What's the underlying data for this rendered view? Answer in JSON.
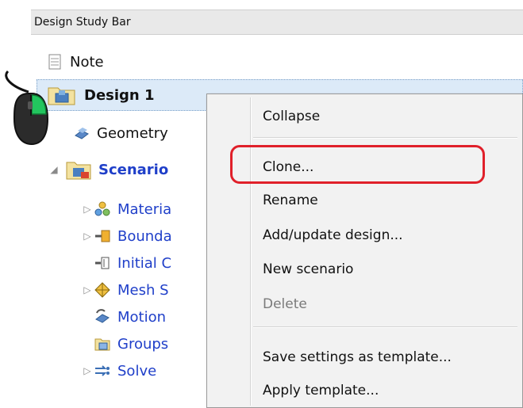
{
  "header": {
    "title": "Design Study Bar"
  },
  "tree": {
    "items": [
      {
        "label": "Note",
        "icon": "note-icon"
      },
      {
        "label": "Design 1",
        "icon": "design-folder-icon"
      },
      {
        "label": "Geometry",
        "icon": "geometry-icon"
      },
      {
        "label": "Scenario",
        "icon": "scenario-folder-icon"
      },
      {
        "label": "Materia",
        "icon": "materials-icon"
      },
      {
        "label": "Bounda",
        "icon": "boundary-conditions-icon"
      },
      {
        "label": "Initial C",
        "icon": "initial-conditions-icon"
      },
      {
        "label": "Mesh S",
        "icon": "mesh-sizes-icon"
      },
      {
        "label": "Motion",
        "icon": "motion-icon"
      },
      {
        "label": "Groups",
        "icon": "groups-icon"
      },
      {
        "label": "Solve",
        "icon": "solve-icon"
      }
    ]
  },
  "context_menu": {
    "items": [
      {
        "label": "Collapse",
        "enabled": true
      },
      {
        "label": "Clone...",
        "enabled": true,
        "highlighted": true
      },
      {
        "label": "Rename",
        "enabled": true
      },
      {
        "label": "Add/update design...",
        "enabled": true
      },
      {
        "label": "New scenario",
        "enabled": true
      },
      {
        "label": "Delete",
        "enabled": false
      },
      {
        "label": "Save settings as template...",
        "enabled": true
      },
      {
        "label": "Apply template...",
        "enabled": true
      }
    ]
  },
  "colors": {
    "selection": "#dceaf8",
    "highlight_outline": "#e0202a",
    "blue_text": "#1f3fc9",
    "mouse_button": "#22c55e"
  }
}
